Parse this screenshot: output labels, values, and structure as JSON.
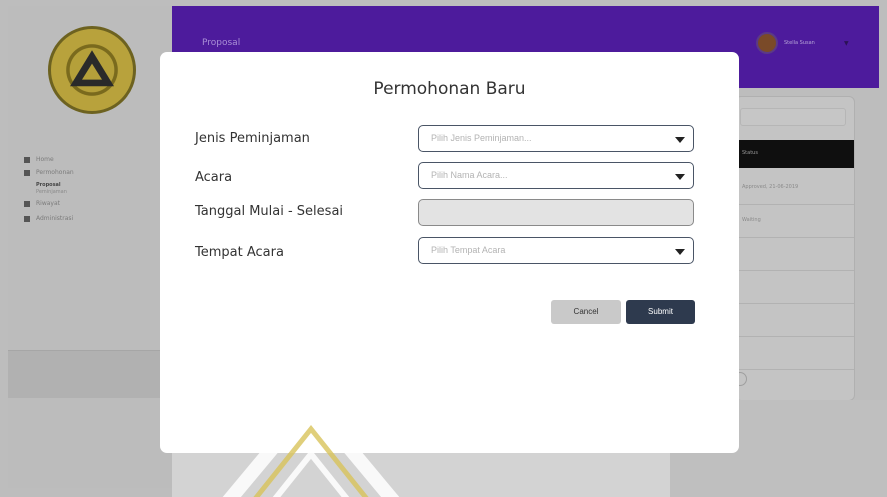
{
  "colors": {
    "topbar": "#4d1b9c",
    "submit_button": "#2e3a4e",
    "cancel_button": "#c9c9c9",
    "backdrop": "#bdbdbd"
  },
  "background": {
    "topbar_title": "Proposal",
    "user_name": "Stella Susan",
    "sidebar": {
      "items": [
        {
          "label": "Home",
          "icon": "home-icon"
        },
        {
          "label": "Permohonan",
          "icon": "folder-icon"
        },
        {
          "label": "Riwayat",
          "icon": "history-icon"
        },
        {
          "label": "Administrasi",
          "icon": "admin-icon"
        }
      ],
      "sub_items": [
        "Proposal",
        "Peminjaman"
      ]
    },
    "table": {
      "header": "Status",
      "rows": [
        "Approved, 21-06-2019",
        "Waiting"
      ]
    }
  },
  "modal": {
    "title": "Permohonan Baru",
    "fields": [
      {
        "label": "Jenis Peminjaman",
        "placeholder": "Pilih Jenis Peminjaman...",
        "type": "select"
      },
      {
        "label": "Acara",
        "placeholder": "Pilih Nama Acara...",
        "type": "select"
      },
      {
        "label": "Tanggal Mulai - Selesai",
        "placeholder": "",
        "type": "disabled-input"
      },
      {
        "label": "Tempat Acara",
        "placeholder": "Pilih Tempat Acara",
        "type": "select"
      }
    ],
    "buttons": {
      "cancel": "Cancel",
      "submit": "Submit"
    }
  }
}
